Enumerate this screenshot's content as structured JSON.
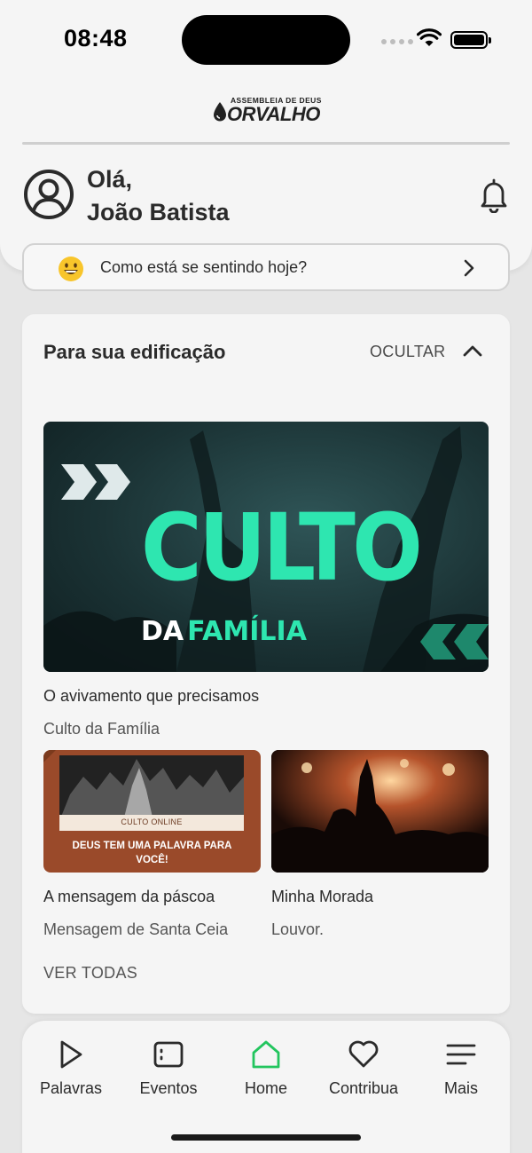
{
  "status_bar": {
    "time": "08:48"
  },
  "brand": {
    "line1": "ASSEMBLEIA DE DEUS",
    "line2": "ORVALHO"
  },
  "greeting": {
    "line1": "Olá,",
    "line2": "João Batista"
  },
  "mood": {
    "label": "Como está se sentindo hoje?"
  },
  "section": {
    "title": "Para sua edificação",
    "toggle_label": "OCULTAR",
    "featured": {
      "image_text_main": "CULTO",
      "image_text_da": "DA",
      "image_text_familia": "FAMÍLIA",
      "title": "O avivamento que precisamos",
      "subtitle": "Culto da Família"
    },
    "items": [
      {
        "image_tag": "CULTO ONLINE",
        "image_caption": "DEUS TEM UMA PALAVRA PARA VOCÊ!",
        "title": "A mensagem da páscoa",
        "subtitle": "Mensagem de Santa Ceia"
      },
      {
        "title": "Minha Morada",
        "subtitle": "Louvor."
      }
    ],
    "see_all_label": "VER TODAS"
  },
  "bottom_nav": {
    "items": [
      {
        "label": "Palavras",
        "icon": "play-icon"
      },
      {
        "label": "Eventos",
        "icon": "calendar-icon"
      },
      {
        "label": "Home",
        "icon": "home-icon"
      },
      {
        "label": "Contribua",
        "icon": "heart-icon"
      },
      {
        "label": "Mais",
        "icon": "menu-icon"
      }
    ]
  },
  "colors": {
    "accent": "#22c55e",
    "featured_text": "#2ee6b0",
    "background": "#e6e6e6",
    "card": "#f5f5f5"
  }
}
